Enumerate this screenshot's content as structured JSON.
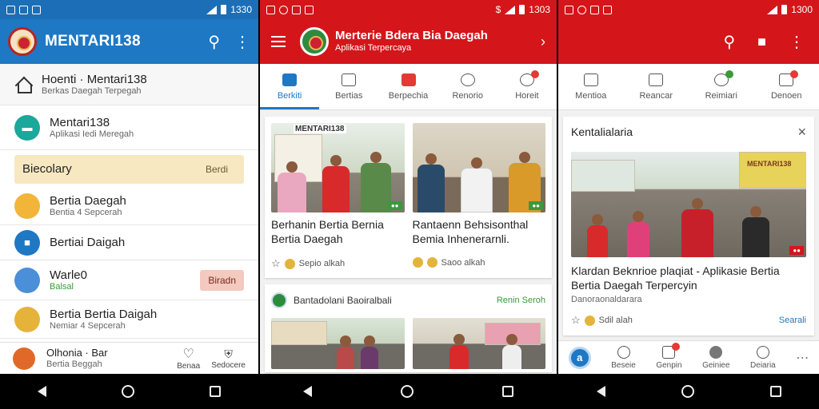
{
  "screen1": {
    "status_time": "1330",
    "app_title": "MENTARI138",
    "rows": [
      {
        "title": "Hoenti · Mentari138",
        "subtitle": "Berkas Daegah Terpegah"
      },
      {
        "title": "Mentari138",
        "subtitle": "Aplikasi Iedi Meregah"
      },
      {
        "title": "Biecolary",
        "subtitle": "",
        "tag": "Berdi"
      },
      {
        "title": "Bertia Daegah",
        "subtitle": "Bentia 4 Sepcerah"
      },
      {
        "title": "Bertiai Daigah",
        "subtitle": ""
      },
      {
        "title": "Warle0",
        "subtitle": "Balsal",
        "tag": "Biradn"
      },
      {
        "title": "Bertia Bertia Daigah",
        "subtitle": "Nemiar 4 Sepcerah"
      },
      {
        "title": "Olhonia · Bar",
        "subtitle": "Bertia Beggah"
      }
    ],
    "bottom_nav": [
      "Benaa",
      "Sedocere"
    ]
  },
  "screen2": {
    "status_time": "1303",
    "brand_title": "Merterie Bdera Bia Daegah",
    "brand_subtitle": "Aplikasi Terpercaya",
    "tabs": [
      {
        "label": "Berkiti",
        "active": true
      },
      {
        "label": "Bertias",
        "active": false
      },
      {
        "label": "Berpechia",
        "active": false
      },
      {
        "label": "Renorio",
        "active": false
      },
      {
        "label": "Horeit",
        "active": false
      }
    ],
    "photo1_sign": "MENTARI138",
    "news": [
      {
        "headline": "Berhanin Bertia Bernia Bertia Daegah",
        "meta": "Sepio alkah"
      },
      {
        "headline": "Rantaenn Behsisonthal Bemia Inhenerarnli.",
        "meta": "Saoo alkah"
      }
    ],
    "section_title": "Bantadolani Baoiralbali",
    "section_link": "Renin Seroh"
  },
  "screen3": {
    "status_time": "1300",
    "tabs": [
      "Mentioa",
      "Reancar",
      "Reimiari",
      "Denoen"
    ],
    "card_title": "Kentalialaria",
    "shop_sign": "MENTARI138",
    "headline": "Klardan Beknrioe plaqiat - Aplikasie Bertia Bertia Daegah Terpercyin",
    "subline": "Danoraonaldarara",
    "meta": "Sdil  alah",
    "link": "Searali",
    "bottom_nav": [
      "Beseie",
      "Genpin",
      "Geiniee",
      "Deiaria"
    ]
  },
  "colors": {
    "blue": "#1e78c4",
    "red": "#d4161b"
  }
}
